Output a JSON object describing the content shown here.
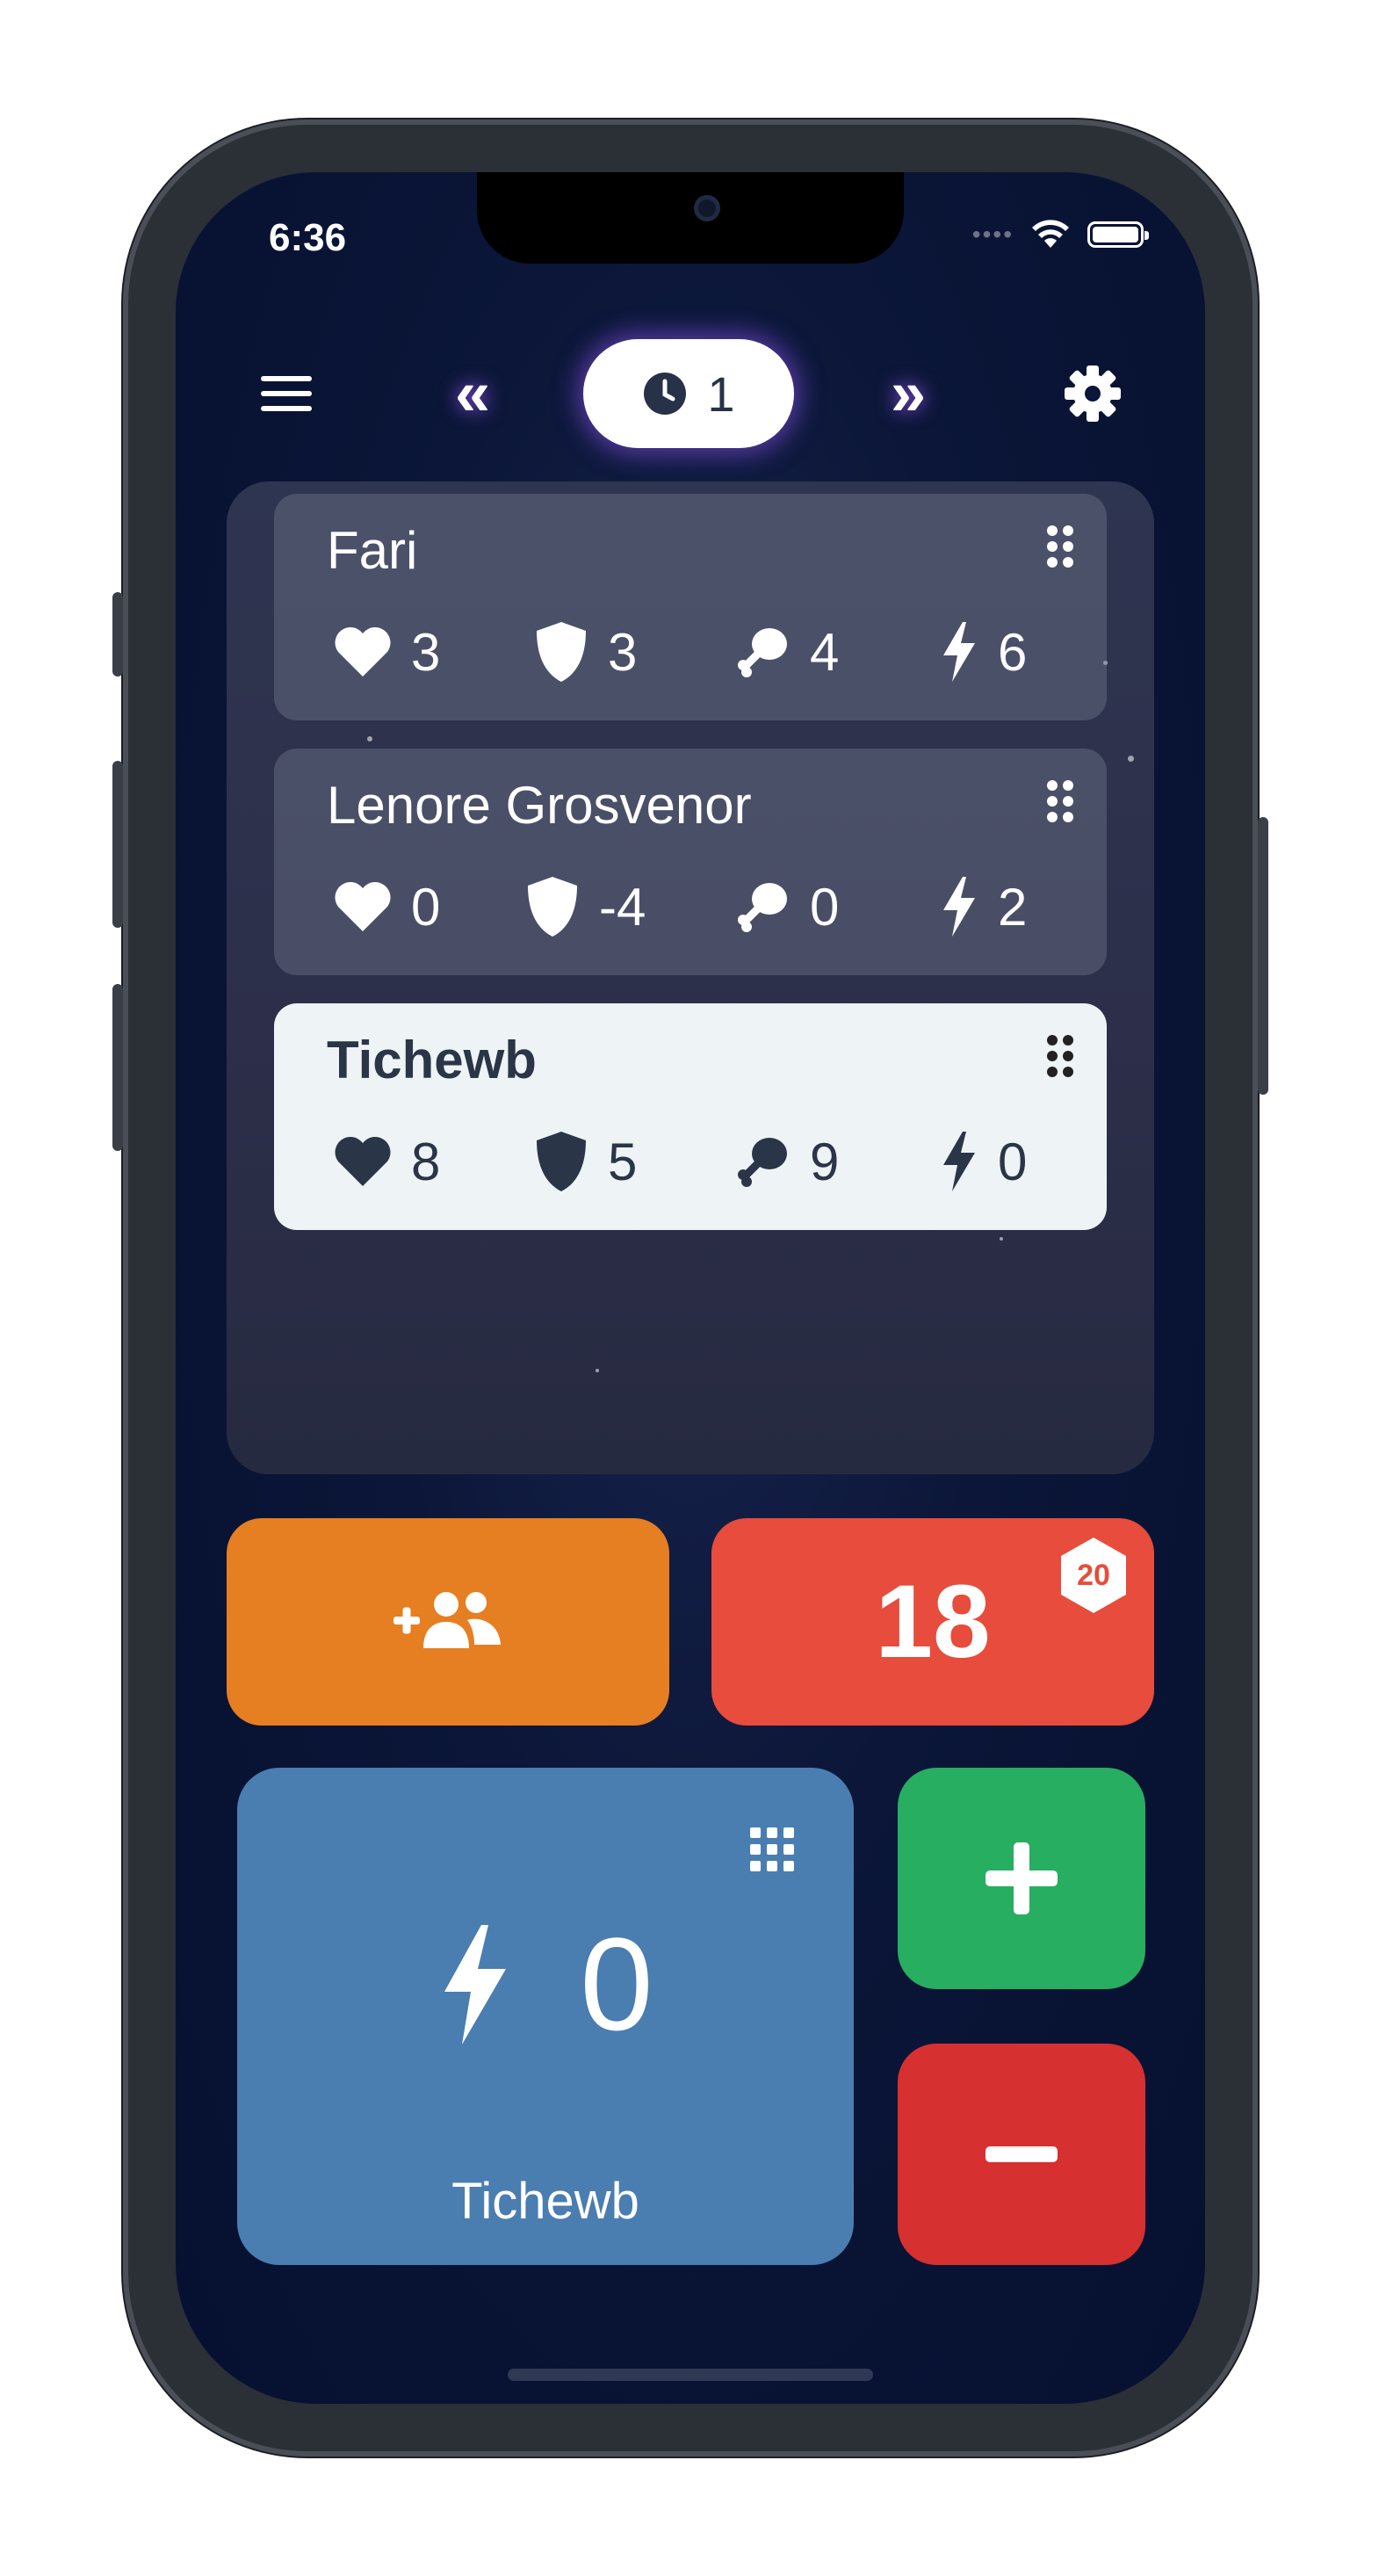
{
  "status_bar": {
    "time": "6:36",
    "signal_dots": "••••"
  },
  "toolbar": {
    "menu_icon": "hamburger-menu-icon",
    "prev_icon": "double-chevron-left-icon",
    "round": {
      "icon": "clock-icon",
      "value": "1"
    },
    "next_icon": "double-chevron-right-icon",
    "settings_icon": "gear-icon"
  },
  "players": [
    {
      "name": "Fari",
      "health": "3",
      "armor": "3",
      "food": "4",
      "energy": "6",
      "selected": false
    },
    {
      "name": "Lenore Grosvenor",
      "health": "0",
      "armor": "-4",
      "food": "0",
      "energy": "2",
      "selected": false
    },
    {
      "name": "Tichewb",
      "health": "8",
      "armor": "5",
      "food": "9",
      "energy": "0",
      "selected": true
    }
  ],
  "actions": {
    "add_players_icon": "add-user-group-icon",
    "dice_roll_value": "18",
    "dice_label": "20",
    "dice_colors": {
      "add": "#e67e22",
      "roll": "#e74c3c"
    }
  },
  "counter": {
    "stat_icon": "lightning-bolt-icon",
    "value": "0",
    "player_name": "Tichewb",
    "keypad_icon": "keypad-grid-icon",
    "increment_icon": "plus-icon",
    "decrement_icon": "minus-icon",
    "colors": {
      "card": "#4a7db0",
      "plus": "#27ae60",
      "minus": "#d63031"
    }
  }
}
